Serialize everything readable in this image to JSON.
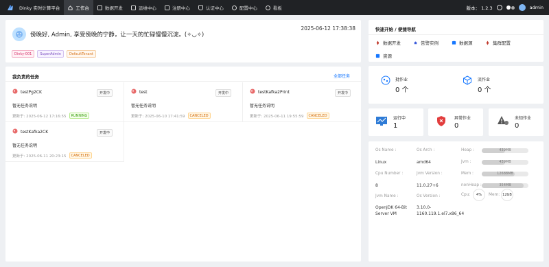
{
  "app": {
    "title": "Dinky 实时计算平台",
    "version_label": "版本：",
    "version": "1.2.3",
    "user": "admin"
  },
  "nav": [
    {
      "label": "工作台",
      "icon": "home-icon"
    },
    {
      "label": "数据开发",
      "icon": "code-icon"
    },
    {
      "label": "运维中心",
      "icon": "monitor-icon"
    },
    {
      "label": "注册中心",
      "icon": "register-icon"
    },
    {
      "label": "认证中心",
      "icon": "shield-icon"
    },
    {
      "label": "配置中心",
      "icon": "gear-icon"
    },
    {
      "label": "看板",
      "icon": "dashboard-icon"
    }
  ],
  "greeting": {
    "text": "傍晚好, Admin, 享受傍晚的宁静，让一天的忙碌慢慢沉淀。(✧◡✧)",
    "datetime": "2025-06-12 17:38:38",
    "tags": [
      "Dinky-001",
      "SuperAdmin",
      "DefaultTenant"
    ]
  },
  "tasks": {
    "title": "我负责的任务",
    "all_link": "全部任务",
    "items": [
      {
        "name": "testPg2CK",
        "status_tag": "开发中",
        "desc": "暂无任务说明",
        "updated": "更新于: 2025-06-12 17:16:55",
        "state": "RUNNING"
      },
      {
        "name": "test",
        "status_tag": "开发中",
        "desc": "暂无任务说明",
        "updated": "更新于: 2025-06-10 17:41:59",
        "state": "CANCELED"
      },
      {
        "name": "testKafka2Print",
        "status_tag": "开发中",
        "desc": "暂无任务说明",
        "updated": "更新于: 2025-06-11 19:55:59",
        "state": "CANCELED"
      },
      {
        "name": "testKafka2CK",
        "status_tag": "开发中",
        "desc": "暂无任务说明",
        "updated": "更新于: 2025-06-11 20:23:15",
        "state": "CANCELED"
      }
    ]
  },
  "quick": {
    "title": "快速开始 / 便捷导航",
    "items": [
      {
        "label": "数据开发",
        "icon": "rocket-icon",
        "color": "#c0392b"
      },
      {
        "label": "告警实例",
        "icon": "bell-icon",
        "color": "#3b5bdb"
      },
      {
        "label": "数据源",
        "icon": "database-icon",
        "color": "#1677ff"
      },
      {
        "label": "集群配置",
        "icon": "cluster-icon",
        "color": "#c0392b"
      },
      {
        "label": "资源",
        "icon": "resource-icon",
        "color": "#1677ff"
      }
    ]
  },
  "stats": {
    "batch": {
      "label": "批作业",
      "value": "0 个"
    },
    "stream": {
      "label": "流作业",
      "value": "0 个"
    },
    "running": {
      "label": "运行中",
      "value": "1"
    },
    "abnormal": {
      "label": "异常作业",
      "value": "0"
    },
    "unknown": {
      "label": "未知作业",
      "value": "0"
    }
  },
  "system": {
    "os_name_label": "Os Name :",
    "os_name": "Linux",
    "os_arch_label": "Os Arch :",
    "os_arch": "amd64",
    "cpu_num_label": "Cpu Number :",
    "cpu_num": "8",
    "jvm_ver_label": "Jvm Version :",
    "jvm_ver": "11.0.27+6",
    "jvm_name_label": "Jvm Name :",
    "jvm_name": "OpenJDK 64-Bit Server VM",
    "os_ver_label": "Os Version :",
    "os_ver": "3.10.0-1160.119.1.el7.x86_64",
    "heap_label": "Heap :",
    "heap": "439MB",
    "jvm_label": "Jvm :",
    "jvm": "439MB",
    "mem_label": "Mem :",
    "mem": "12688MB",
    "nonheap_label": "nonHeap :",
    "nonheap": "354MB",
    "cpu_label": "Cpu:",
    "cpu": "4%",
    "mem2_label": "Mem:",
    "mem2": "12GB",
    "heap_fill": 0.5,
    "jvm_fill": 0.5,
    "mem_fill": 0.7,
    "nonheap_fill": 0.9
  }
}
